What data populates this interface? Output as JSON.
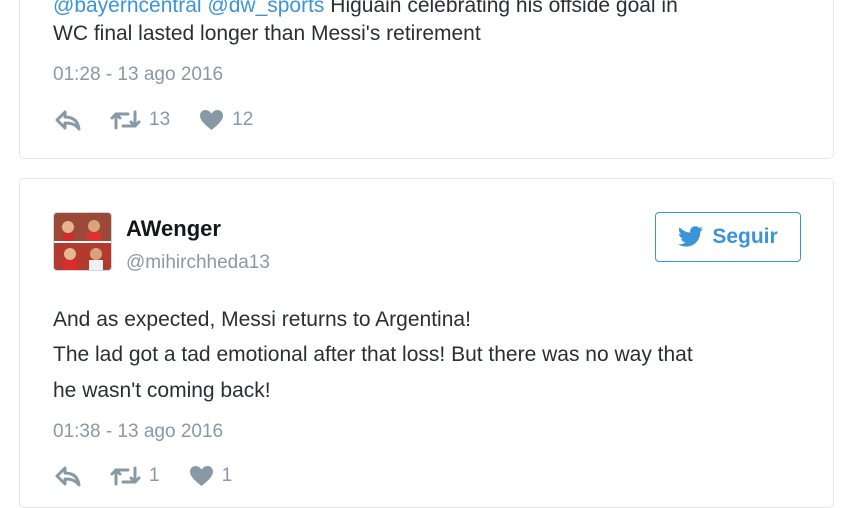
{
  "tweet1": {
    "mentions": [
      "@bayerncentral",
      "@dw_sports"
    ],
    "text_line1": " Higuain celebrating his offside goal in",
    "text_line2": "WC final lasted longer than Messi's retirement",
    "timestamp": "01:28 - 13 ago 2016",
    "retweet_count": "13",
    "like_count": "12"
  },
  "tweet2": {
    "display_name": "AWenger",
    "handle": "@mihirchheda13",
    "follow_label": "Seguir",
    "text_lines": [
      "And as expected, Messi returns to Argentina!",
      "The lad got a tad emotional after that loss! But there was no way that",
      "he wasn't coming back!"
    ],
    "timestamp": "01:38 - 13 ago 2016",
    "retweet_count": "1",
    "like_count": "1"
  },
  "colors": {
    "link": "#3b94d9",
    "muted": "#8899a6",
    "text": "#292f33",
    "border": "#e1e8ed"
  },
  "icons": [
    "reply-icon",
    "retweet-icon",
    "heart-icon",
    "twitter-bird-icon"
  ]
}
